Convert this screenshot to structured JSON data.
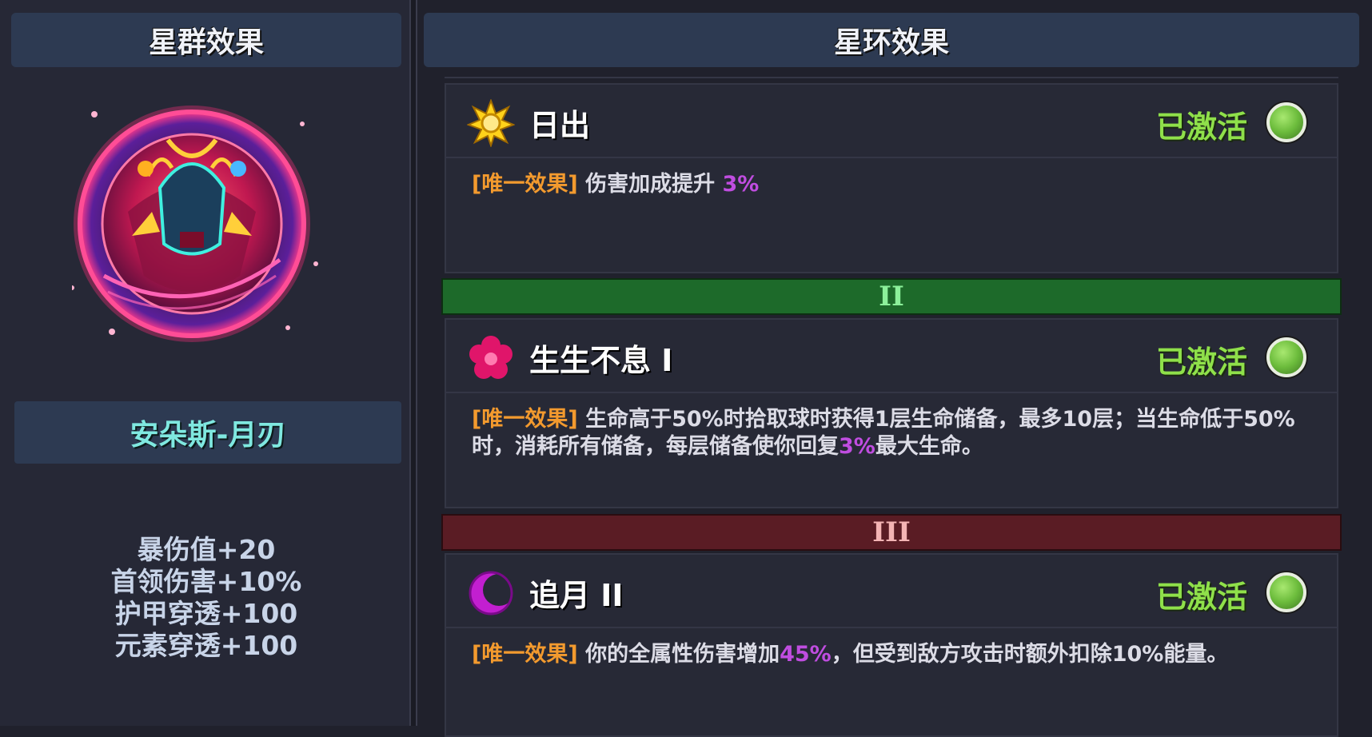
{
  "left_panel": {
    "header": "星群效果",
    "constellation_name": "安朵斯-月刃",
    "stats": [
      "暴伤值+20",
      "首领伤害+10%",
      "护甲穿透+100",
      "元素穿透+100"
    ]
  },
  "right_panel": {
    "header": "星环效果",
    "rings": [
      {
        "title": "日出",
        "icon": "sun-icon",
        "status": "已激活",
        "tag": "[唯一效果]",
        "text_a": " 伤害加成提升 ",
        "highlight": "3%",
        "text_b": ""
      },
      {
        "tier": "II",
        "title": "生生不息 I",
        "icon": "flower-icon",
        "status": "已激活",
        "tag": "[唯一效果]",
        "text_a": " 生命高于50%时拾取球时获得1层生命储备，最多10层；当生命低于50%时，消耗所有储备，每层储备使你回复",
        "highlight": "3%",
        "text_b": "最大生命。"
      },
      {
        "tier": "III",
        "title": "追月 II",
        "icon": "moon-icon",
        "status": "已激活",
        "tag": "[唯一效果]",
        "text_a": " 你的全属性伤害增加",
        "highlight": "45%",
        "text_b": "，但受到敌方攻击时额外扣除10%能量。"
      }
    ]
  },
  "colors": {
    "status_active": "#8fe04a",
    "tag": "#f39a2e",
    "highlight": "#c04de0",
    "tier_2_bar": "#1d6a2a",
    "tier_3_bar": "#5a1c24"
  }
}
